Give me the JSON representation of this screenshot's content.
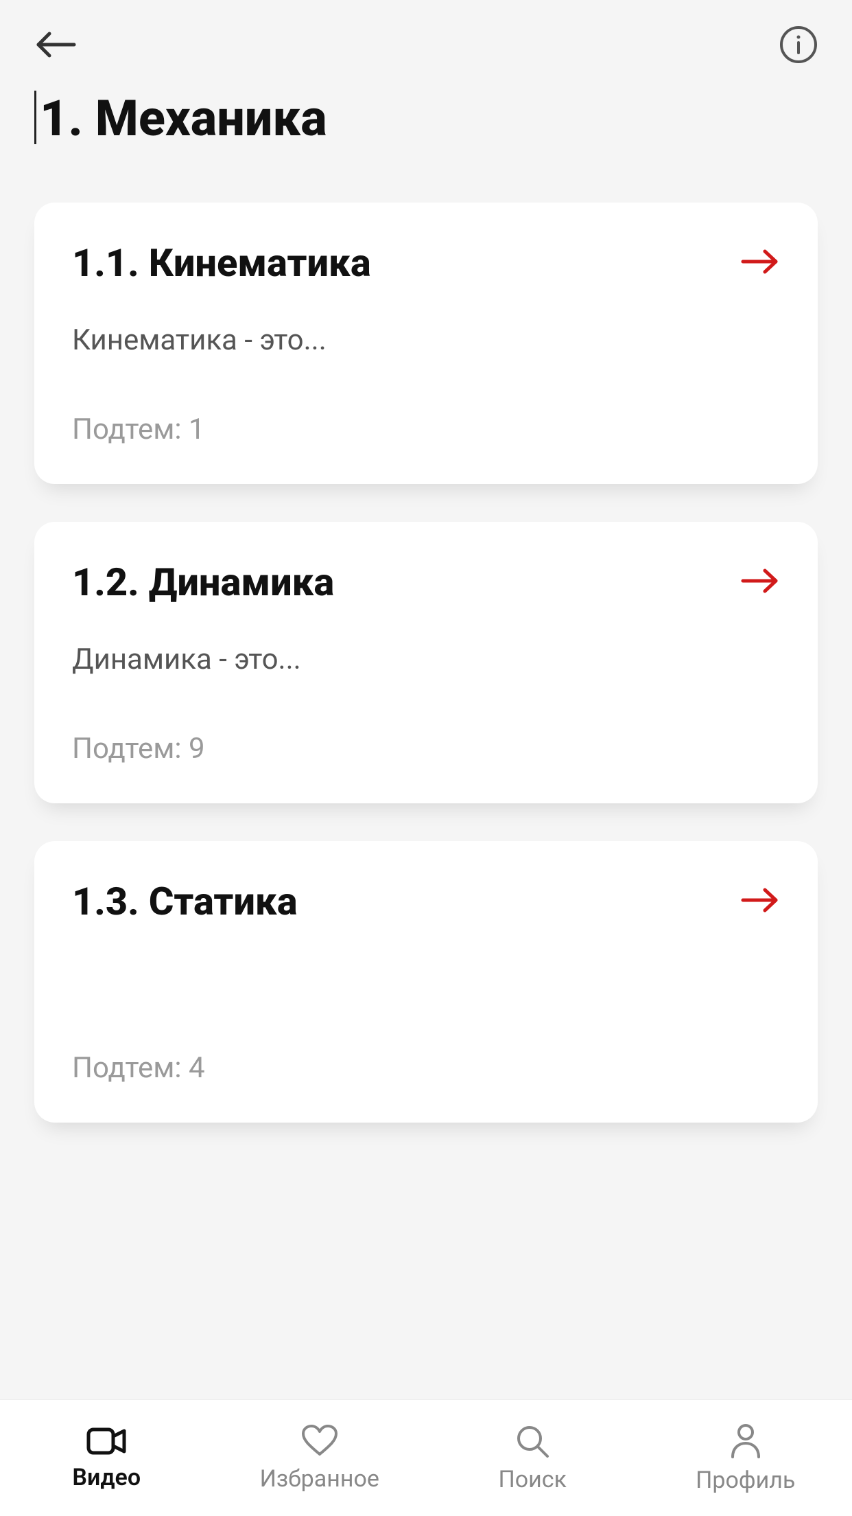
{
  "header": {
    "title": "1. Механика"
  },
  "topics": [
    {
      "title": "1.1. Кинематика",
      "description": "Кинематика - это...",
      "subcount_label": "Подтем: 1"
    },
    {
      "title": "1.2. Динамика",
      "description": "Динамика - это...",
      "subcount_label": "Подтем: 9"
    },
    {
      "title": "1.3. Статика",
      "description": "",
      "subcount_label": "Подтем: 4"
    }
  ],
  "nav": {
    "video": "Видео",
    "favorites": "Избранное",
    "search": "Поиск",
    "profile": "Профиль"
  },
  "colors": {
    "accent_red": "#d11a1a"
  }
}
